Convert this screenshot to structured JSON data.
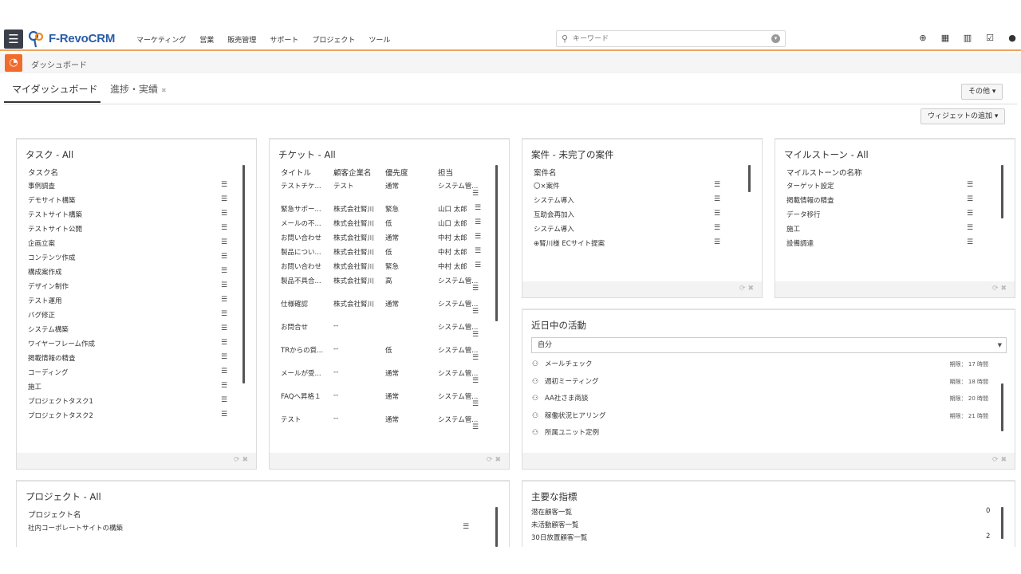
{
  "nav": {
    "logo": "F-RevoCRM",
    "logo_prefix": "F-",
    "logo_suffix": "RevoCRM",
    "menu": [
      "マーケティング",
      "営業",
      "販売管理",
      "サポート",
      "プロジェクト",
      "ツール"
    ],
    "search_placeholder": "キーワード",
    "tools": [
      "plus-circle-icon",
      "calendar-icon",
      "chart-icon",
      "checkbox-icon",
      "user-icon"
    ]
  },
  "breadcrumb": {
    "title": "ダッシュボード"
  },
  "tabs": {
    "my_dashboard": "マイダッシュボード",
    "progress": "進捗・実績"
  },
  "buttons": {
    "other": "その他",
    "add_widget": "ウィジェットの追加"
  },
  "widgets": {
    "tasks": {
      "title": "タスク - All",
      "header": "タスク名",
      "rows": [
        "事例調査",
        "デモサイト構築",
        "テストサイト構築",
        "テストサイト公開",
        "企画立案",
        "コンテンツ作成",
        "構成案作成",
        "デザイン制作",
        "テスト運用",
        "バグ修正",
        "システム構築",
        "ワイヤーフレーム作成",
        "掲載情報の精査",
        "コーディング",
        "施工",
        "プロジェクトタスク1",
        "プロジェクトタスク2"
      ]
    },
    "tickets": {
      "title": "チケット - All",
      "headers": [
        "タイトル",
        "顧客企業名",
        "優先度",
        "担当"
      ],
      "rows": [
        [
          "テストチケ...",
          "テスト",
          "通常",
          "システム管..."
        ],
        [
          "緊急サポー...",
          "株式会社腎川",
          "緊急",
          "山口 太郎"
        ],
        [
          "メールの不...",
          "株式会社腎川",
          "低",
          "山口 太郎"
        ],
        [
          "お問い合わせ",
          "株式会社腎川",
          "通常",
          "中村 太郎"
        ],
        [
          "製品につい...",
          "株式会社腎川",
          "低",
          "中村 太郎"
        ],
        [
          "お問い合わせ",
          "株式会社腎川",
          "緊急",
          "中村 太郎"
        ],
        [
          "製品不具合...",
          "株式会社腎川",
          "高",
          "システム管..."
        ],
        [
          "仕様確認",
          "株式会社腎川",
          "通常",
          "システム管..."
        ],
        [
          "お問合せ",
          "--",
          "",
          "システム管..."
        ],
        [
          "TRからの質...",
          "--",
          "低",
          "システム管..."
        ],
        [
          "メールが受...",
          "--",
          "通常",
          "システム管..."
        ],
        [
          "FAQへ昇格１",
          "--",
          "通常",
          "システム管..."
        ],
        [
          "テスト",
          "--",
          "通常",
          "システム管..."
        ]
      ]
    },
    "deals": {
      "title": "案件 - 未完了の案件",
      "header": "案件名",
      "rows": [
        "〇×案件",
        "システム導入",
        "互助会再加入",
        "システム導入",
        "⊕腎川様 ECサイト提案"
      ]
    },
    "milestones": {
      "title": "マイルストーン - All",
      "header": "マイルストーンの名称",
      "rows": [
        "ターゲット設定",
        "掲載情報の精査",
        "データ移行",
        "施工",
        "設備調達"
      ]
    },
    "activities": {
      "title": "近日中の活動",
      "filter": "自分",
      "rows": [
        {
          "title": "メールチェック",
          "due": "期限： 17 時間"
        },
        {
          "title": "週初ミーティング",
          "due": "期限： 18 時間"
        },
        {
          "title": "AA社さま商談",
          "due": "期限： 20 時間"
        },
        {
          "title": "稼働状況ヒアリング",
          "due": "期限： 21 時間"
        },
        {
          "title": "所属ユニット定例",
          "due": ""
        }
      ]
    },
    "projects": {
      "title": "プロジェクト - All",
      "header": "プロジェクト名",
      "rows": [
        "社内コーポレートサイトの構築"
      ]
    },
    "kpis": {
      "title": "主要な指標",
      "rows": [
        {
          "label": "潜在顧客一覧",
          "value": "0"
        },
        {
          "label": "未活動顧客一覧",
          "value": ""
        },
        {
          "label": "30日放置顧客一覧",
          "value": "2"
        }
      ]
    }
  },
  "colors": {
    "accent": "#f26b2a",
    "nav_border": "#f0a35e",
    "logo_blue": "#2a5da8"
  }
}
